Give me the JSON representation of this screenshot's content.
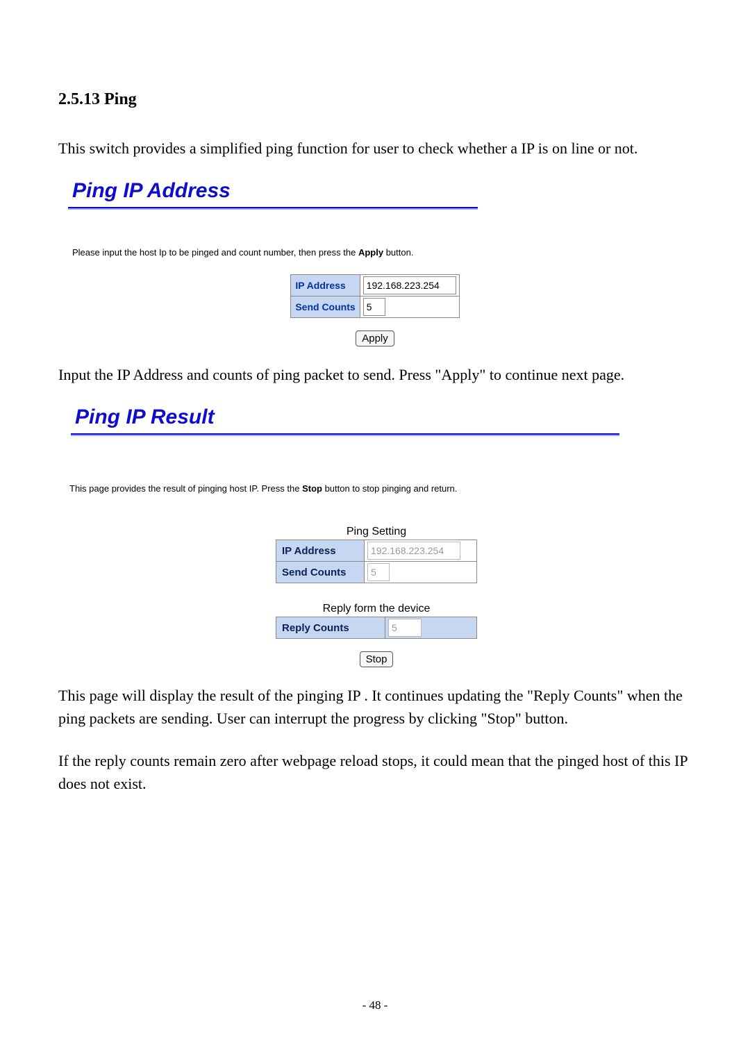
{
  "doc": {
    "heading": "2.5.13 Ping",
    "intro": "This switch provides a simplified ping function for user to check whether a IP is on line or not.",
    "after_shot1": "Input the IP Address and counts of ping packet to send. Press \"Apply\" to continue next page.",
    "after_shot2_p1": "This page will display the result of the pinging IP . It continues updating the \"Reply Counts\" when the ping packets are sending. User can interrupt the progress by clicking \"Stop\" button.",
    "after_shot2_p2": "If the reply counts remain zero after webpage reload stops, it could mean that the pinged host of this IP does not exist.",
    "page_number": "- 48 -"
  },
  "shot1": {
    "title": "Ping IP Address",
    "instr_prefix": "Please input the host Ip to be pinged and count number, then press the ",
    "instr_bold": "Apply",
    "instr_suffix": " button.",
    "row1_label": "IP Address",
    "row1_value": "192.168.223.254",
    "row2_label": "Send Counts",
    "row2_value": "5",
    "button": "Apply"
  },
  "shot2": {
    "title": "Ping IP Result",
    "instr_prefix": "This page provides the result of pinging host IP. Press the ",
    "instr_bold": "Stop",
    "instr_suffix": " button to stop pinging and return.",
    "caption1": "Ping Setting",
    "row1_label": "IP Address",
    "row1_value": "192.168.223.254",
    "row2_label": "Send Counts",
    "row2_value": "5",
    "caption2": "Reply form the device",
    "row3_label": "Reply Counts",
    "row3_value": "5",
    "button": "Stop"
  }
}
